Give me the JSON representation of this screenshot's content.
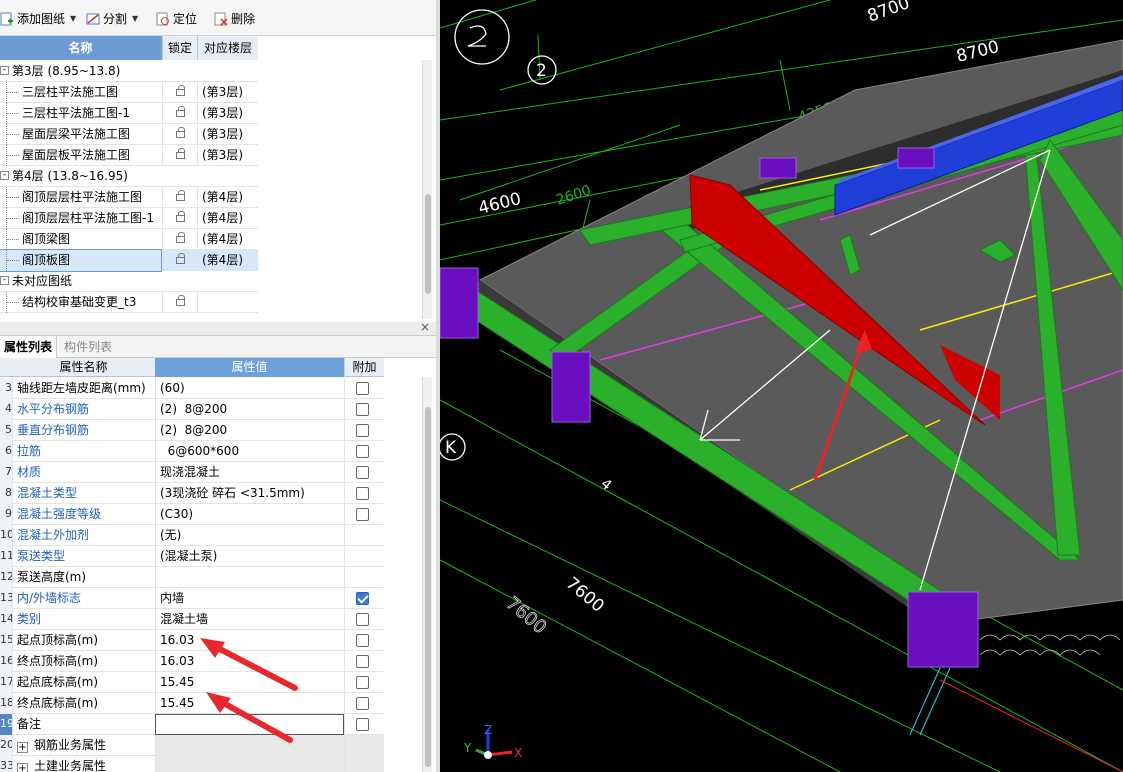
{
  "toolbar": {
    "add_drawing": "添加图纸",
    "split": "分割",
    "locate": "定位",
    "delete": "删除"
  },
  "drawing_table": {
    "headers": {
      "name": "名称",
      "lock": "锁定",
      "floor": "对应楼层"
    },
    "rows": [
      {
        "name": "第3层 (8.95~13.8)",
        "group": true,
        "expander": "-"
      },
      {
        "name": "三层柱平法施工图",
        "floor": "(第3层)"
      },
      {
        "name": "三层柱平法施工图-1",
        "floor": "(第3层)"
      },
      {
        "name": "屋面层梁平法施工图",
        "floor": "(第3层)"
      },
      {
        "name": "屋面层板平法施工图",
        "floor": "(第3层)"
      },
      {
        "name": "第4层 (13.8~16.95)",
        "group": true,
        "expander": "-"
      },
      {
        "name": "阁顶层层柱平法施工图",
        "floor": "(第4层)"
      },
      {
        "name": "阁顶层层柱平法施工图-1",
        "floor": "(第4层)"
      },
      {
        "name": "阁顶梁图",
        "floor": "(第4层)"
      },
      {
        "name": "阁顶板图",
        "floor": "(第4层)",
        "selected": true
      },
      {
        "name": "未对应图纸",
        "group": true,
        "expander": "-"
      },
      {
        "name": "结构校审基础变更_t3",
        "floor": ""
      }
    ]
  },
  "props": {
    "close": "×",
    "tabs": {
      "active": "属性列表",
      "inactive": "构件列表"
    },
    "headers": {
      "name": "属性名称",
      "value": "属性值",
      "add": "附加"
    },
    "rows": [
      {
        "num": "3",
        "name": "轴线距左墙皮距离(mm)",
        "value": "(60)",
        "blue": false,
        "checkbox": "off"
      },
      {
        "num": "4",
        "name": "水平分布钢筋",
        "value": "(2)  8@200",
        "blue": true,
        "checkbox": "off"
      },
      {
        "num": "5",
        "name": "垂直分布钢筋",
        "value": "(2)  8@200",
        "blue": true,
        "checkbox": "off"
      },
      {
        "num": "6",
        "name": "拉筋",
        "value": "  6@600*600",
        "blue": true,
        "checkbox": "off"
      },
      {
        "num": "7",
        "name": "材质",
        "value": "现浇混凝土",
        "blue": true,
        "checkbox": "off"
      },
      {
        "num": "8",
        "name": "混凝土类型",
        "value": "(3现浇砼 碎石 <31.5mm)",
        "blue": true,
        "checkbox": "off"
      },
      {
        "num": "9",
        "name": "混凝土强度等级",
        "value": "(C30)",
        "blue": true,
        "checkbox": "off"
      },
      {
        "num": "10",
        "name": "混凝土外加剂",
        "value": "(无)",
        "blue": true,
        "checkbox": "none"
      },
      {
        "num": "11",
        "name": "泵送类型",
        "value": "(混凝土泵)",
        "blue": true,
        "checkbox": "none"
      },
      {
        "num": "12",
        "name": "泵送高度(m)",
        "value": "",
        "blue": false,
        "checkbox": "none"
      },
      {
        "num": "13",
        "name": "内/外墙标志",
        "value": "内墙",
        "blue": true,
        "checkbox": "on"
      },
      {
        "num": "14",
        "name": "类别",
        "value": "混凝土墙",
        "blue": true,
        "checkbox": "off"
      },
      {
        "num": "15",
        "name": "起点顶标高(m)",
        "value": "16.03",
        "blue": false,
        "checkbox": "off"
      },
      {
        "num": "16",
        "name": "终点顶标高(m)",
        "value": "16.03",
        "blue": false,
        "checkbox": "off"
      },
      {
        "num": "17",
        "name": "起点底标高(m)",
        "value": "15.45",
        "blue": false,
        "checkbox": "off"
      },
      {
        "num": "18",
        "name": "终点底标高(m)",
        "value": "15.45",
        "blue": false,
        "checkbox": "off"
      },
      {
        "num": "19",
        "name": "备注",
        "value": "",
        "blue": false,
        "checkbox": "off",
        "input": true,
        "highlight": true
      },
      {
        "num": "20",
        "name": "钢筋业务属性",
        "value": "",
        "blue": false,
        "checkbox": "gray",
        "expand": true
      },
      {
        "num": "33",
        "name": "土建业务属性",
        "value": "",
        "blue": false,
        "checkbox": "gray",
        "expand": true
      }
    ]
  },
  "viewport": {
    "dimensions": [
      "8700",
      "8700",
      "4350",
      "4600",
      "2600",
      "7600",
      "7600",
      "4"
    ],
    "axis_labels": [
      "2",
      "K"
    ],
    "axis_gizmo": {
      "x": "X",
      "y": "Y",
      "z": "Z"
    },
    "colors": {
      "background": "#000000",
      "slab": "#5a5a5a",
      "beam": "#22aa22",
      "column": "#6a0fc0",
      "highlight": "#cc0000",
      "top_beam": "#1f3fd8"
    }
  }
}
